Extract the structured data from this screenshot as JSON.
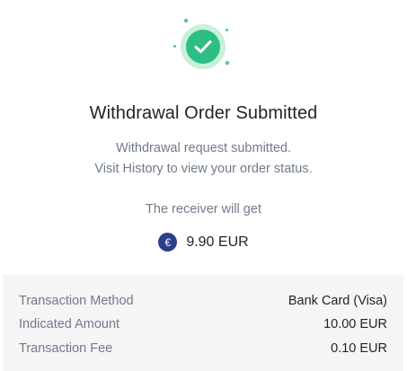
{
  "success": {
    "icon": "check-circle-icon",
    "accent_color": "#2ebd85",
    "ring_color": "#c8f0da"
  },
  "title": "Withdrawal Order Submitted",
  "message": {
    "line1": "Withdrawal request submitted.",
    "line2": "Visit History to view your order status."
  },
  "receiver_label": "The receiver will get",
  "amount": {
    "currency_icon": "euro-icon",
    "currency_symbol": "€",
    "value": "9.90 EUR"
  },
  "details": [
    {
      "label": "Transaction Method",
      "value": "Bank Card (Visa)"
    },
    {
      "label": "Indicated Amount",
      "value": "10.00 EUR"
    },
    {
      "label": "Transaction Fee",
      "value": "0.10 EUR"
    }
  ]
}
